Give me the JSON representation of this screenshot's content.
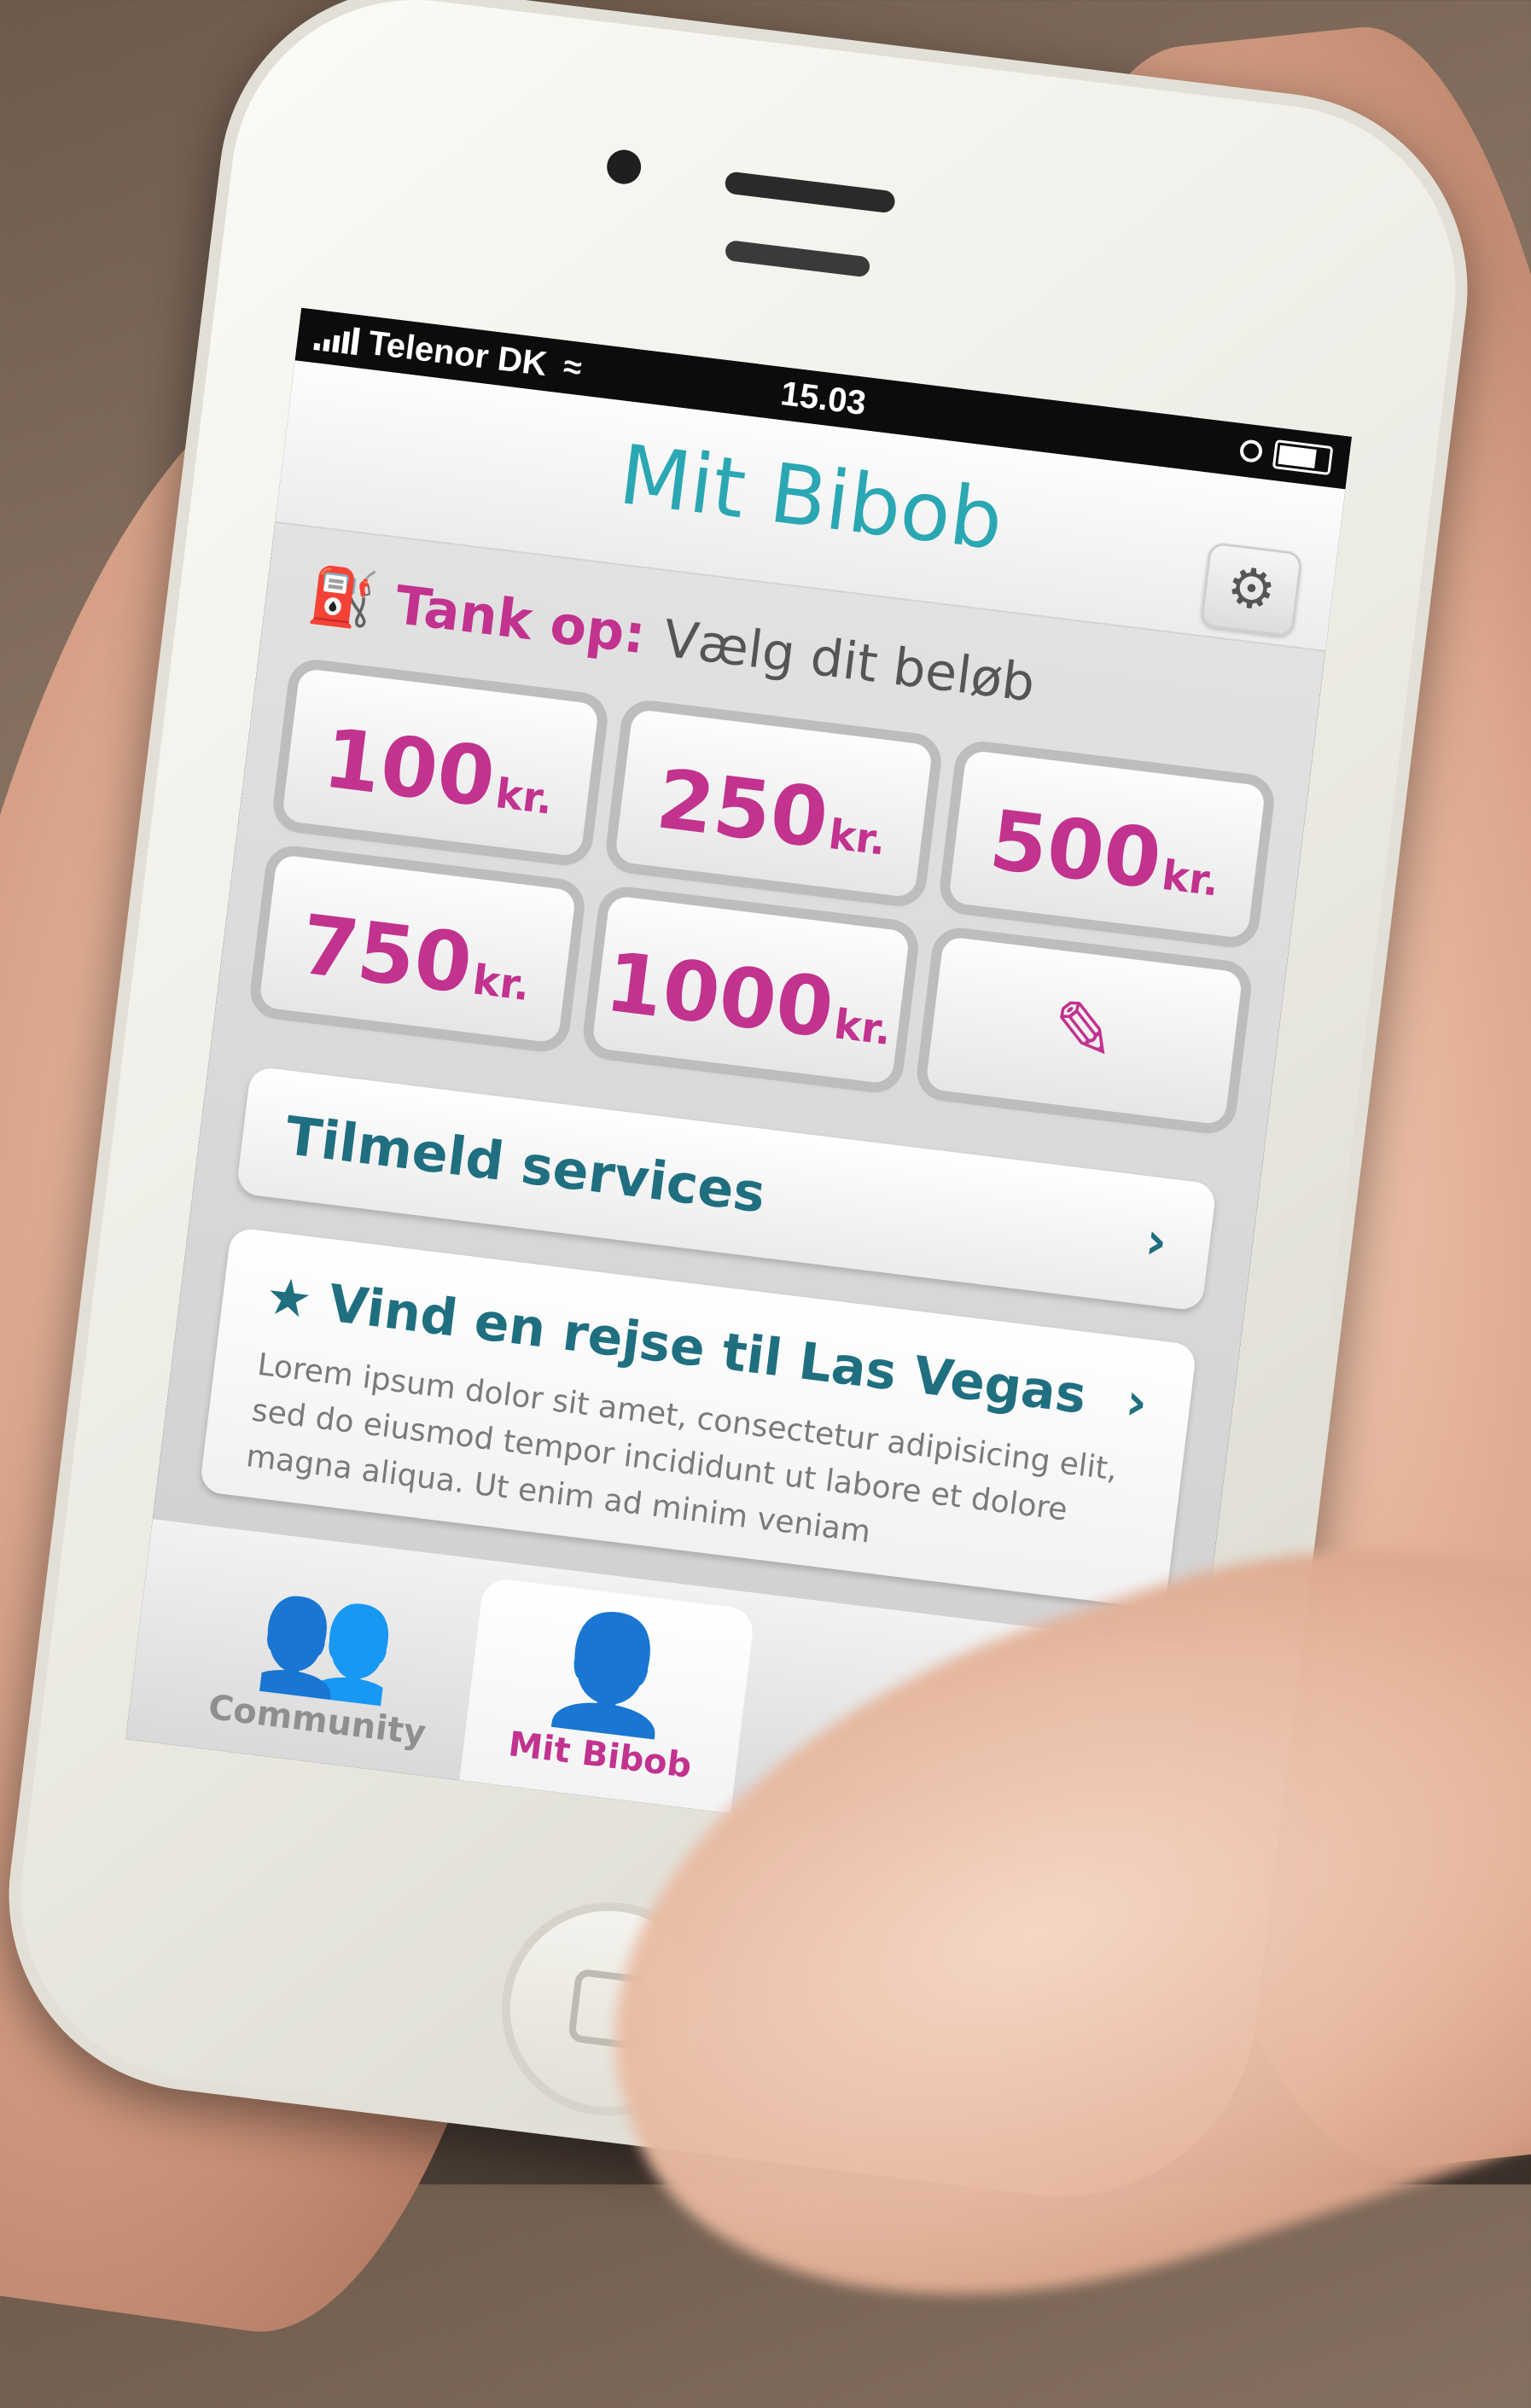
{
  "status": {
    "carrier": "Telenor DK",
    "time": "15.03",
    "wifi_icon": "wifi-icon",
    "alarm_icon": "alarm-icon",
    "battery_icon": "battery-icon"
  },
  "navbar": {
    "title": "Mit Bibob",
    "settings_icon": "gear-icon"
  },
  "tank": {
    "icon": "fuel-pump-icon",
    "label": "Tank op:",
    "hint": "Vælg dit beløb"
  },
  "amounts": [
    {
      "value": "100",
      "unit": "kr."
    },
    {
      "value": "250",
      "unit": "kr."
    },
    {
      "value": "500",
      "unit": "kr."
    },
    {
      "value": "750",
      "unit": "kr."
    },
    {
      "value": "1000",
      "unit": "kr."
    }
  ],
  "amount_edit_icon": "pencil-icon",
  "services": {
    "label": "Tilmeld services",
    "chevron_icon": "chevron-right-icon"
  },
  "promo": {
    "star_icon": "star-icon",
    "title": "Vind en rejse til Las Vegas",
    "text": "Lorem ipsum dolor sit amet, consectetur adipisicing elit, sed do eiusmod tempor incididunt ut labore et dolore magna aliqua. Ut enim ad minim veniam",
    "chevron_icon": "chevron-right-icon"
  },
  "tabs": [
    {
      "label": "Community",
      "icon": "community-icon"
    },
    {
      "label": "Mit Bibob",
      "icon": "person-icon"
    }
  ],
  "colors": {
    "accent_teal": "#2aa7b3",
    "accent_magenta": "#c2328f",
    "dark_teal": "#1f6f80"
  }
}
